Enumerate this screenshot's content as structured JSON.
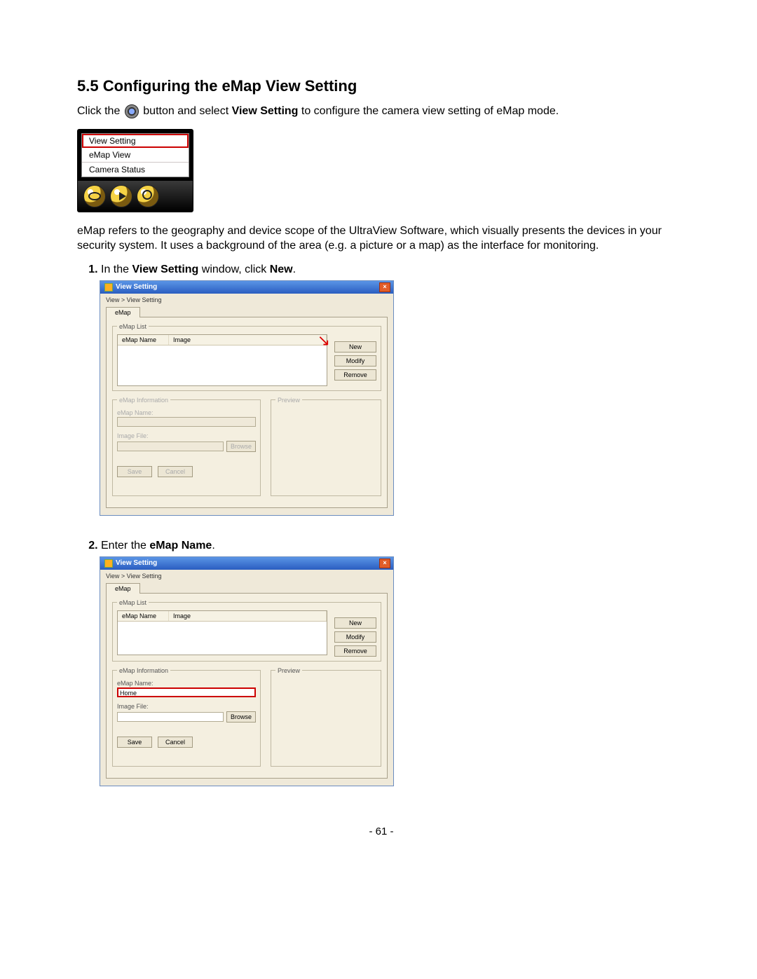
{
  "heading": "5.5  Configuring the eMap View Setting",
  "intro": {
    "pre": "Click the",
    "mid1": "button and select",
    "bold1": "View Setting",
    "post1": "to configure the camera view setting of eMap mode."
  },
  "menu": {
    "items": [
      "View Setting",
      "eMap View",
      "Camera Status"
    ]
  },
  "para2": "eMap refers to the geography and device scope of the UltraView Software, which visually presents the devices in your security system. It uses a background of the area (e.g. a picture or a map) as the interface for monitoring.",
  "steps": {
    "s1": {
      "pre": "In the",
      "b1": "View Setting",
      "mid": "window, click",
      "b2": "New",
      "post": "."
    },
    "s2": {
      "pre": "Enter the",
      "b1": "eMap Name",
      "post": "."
    }
  },
  "vs": {
    "title": "View Setting",
    "crumb": "View > View Setting",
    "tab": "eMap",
    "group_list": "eMap List",
    "col_name": "eMap Name",
    "col_image": "Image",
    "btn_new": "New",
    "btn_modify": "Modify",
    "btn_remove": "Remove",
    "group_info": "eMap Information",
    "lbl_emapname": "eMap Name:",
    "lbl_imagefile": "Image File:",
    "btn_browse": "Browse",
    "group_preview": "Preview",
    "btn_save": "Save",
    "btn_cancel": "Cancel",
    "input_home": "Home"
  },
  "pagenum": "- 61 -"
}
